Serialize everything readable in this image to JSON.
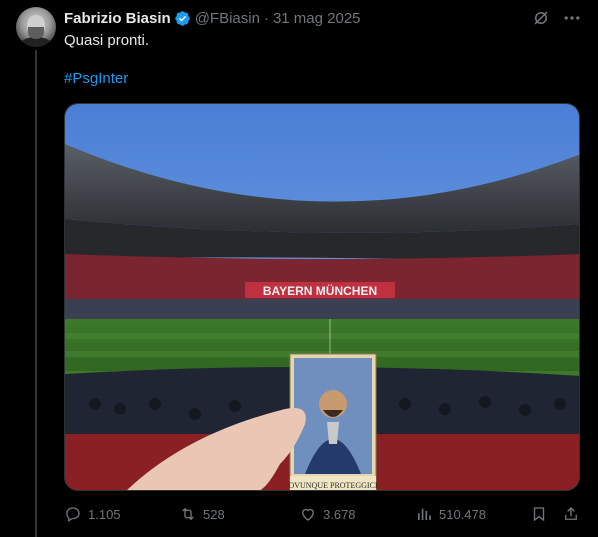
{
  "author": {
    "name": "Fabrizio Biasin",
    "handle": "@FBiasin",
    "separator": "·",
    "date": "31 mag 2025",
    "verified": true
  },
  "tweet": {
    "text": "Quasi pronti.",
    "hashtag": "#PsgInter"
  },
  "media": {
    "stadium_lettering": "BAYERN MÜNCHEN",
    "card_caption": "OVUNQUE PROTEGGICI"
  },
  "actions": {
    "replies": "1.105",
    "retweets": "528",
    "likes": "3.678",
    "views": "510.478"
  },
  "colors": {
    "background": "#000000",
    "text": "#e7e9ea",
    "muted": "#71767b",
    "link": "#1d9bf0",
    "verified": "#1d9bf0"
  },
  "icons": [
    "more-icon",
    "grok-icon",
    "reply-icon",
    "retweet-icon",
    "like-icon",
    "views-icon",
    "bookmark-icon",
    "share-icon",
    "verified-badge-icon"
  ]
}
